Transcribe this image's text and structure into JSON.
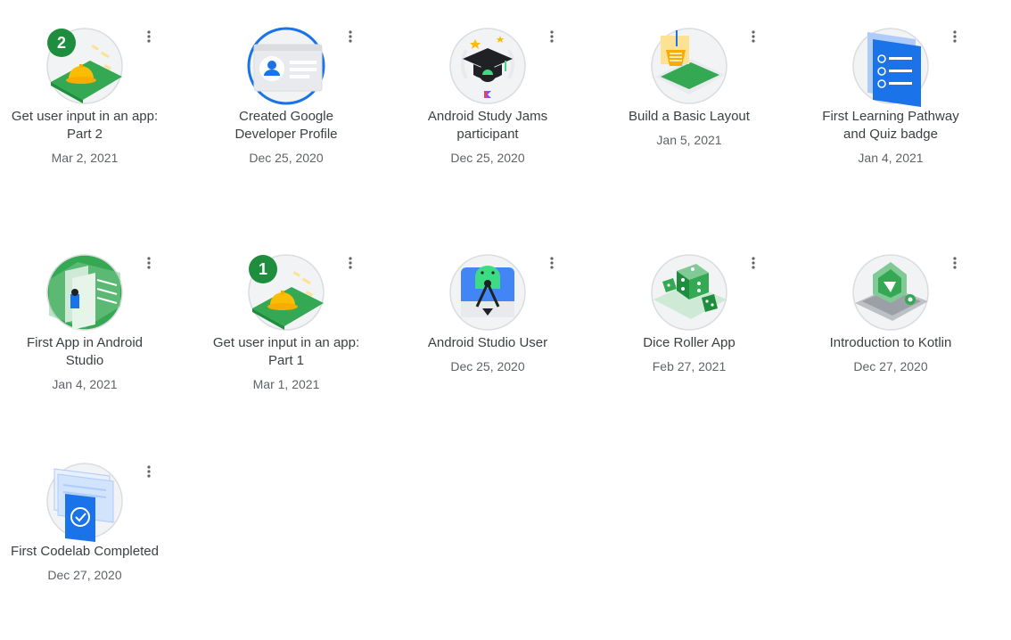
{
  "colors": {
    "green": "#34a853",
    "dark_green": "#1e8e3e",
    "blue": "#1a73e8",
    "yellow": "#fbbc04",
    "grey": "#dadce0",
    "text": "#3c4043",
    "subtext": "#5f6368"
  },
  "badges": [
    {
      "name": "Get user input in an app: Part 2",
      "date": "Mar 2, 2021",
      "icon": "user-input-part2-badge-icon",
      "number": "2"
    },
    {
      "name": "Created Google Developer Profile",
      "date": "Dec 25, 2020",
      "icon": "developer-profile-badge-icon"
    },
    {
      "name": "Android Study Jams participant",
      "date": "Dec 25, 2020",
      "icon": "study-jams-graduation-cap-icon"
    },
    {
      "name": "Build a Basic Layout",
      "date": "Jan 5, 2021",
      "icon": "basic-layout-badge-icon"
    },
    {
      "name": "First Learning Pathway and Quiz badge",
      "date": "Jan 4, 2021",
      "icon": "learning-pathway-quiz-badge-icon"
    },
    {
      "name": "First App in Android Studio",
      "date": "Jan 4, 2021",
      "icon": "first-app-android-studio-badge-icon"
    },
    {
      "name": "Get user input in an app: Part 1",
      "date": "Mar 1, 2021",
      "icon": "user-input-part1-badge-icon",
      "number": "1"
    },
    {
      "name": "Android Studio User",
      "date": "Dec 25, 2020",
      "icon": "android-studio-user-badge-icon"
    },
    {
      "name": "Dice Roller App",
      "date": "Feb 27, 2021",
      "icon": "dice-roller-badge-icon"
    },
    {
      "name": "Introduction to Kotlin",
      "date": "Dec 27, 2020",
      "icon": "kotlin-intro-badge-icon"
    },
    {
      "name": "First Codelab Completed",
      "date": "Dec 27, 2020",
      "icon": "first-codelab-badge-icon"
    }
  ]
}
